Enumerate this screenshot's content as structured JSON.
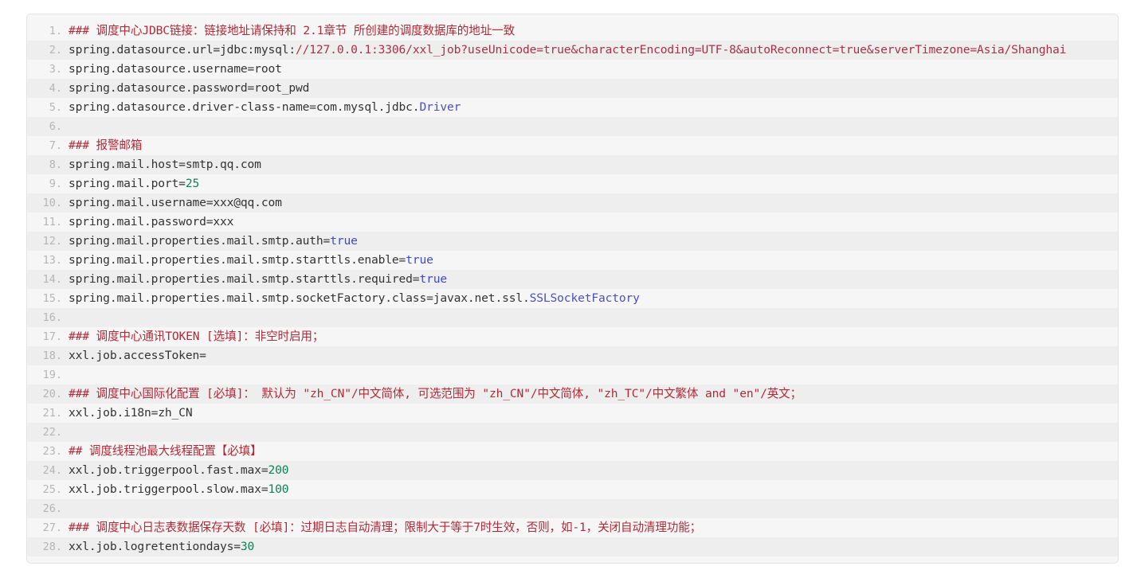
{
  "block": {
    "language": "properties",
    "colors": {
      "background_odd": "#f6f6f6",
      "background_even": "#eeeeee",
      "border": "#e4e4e4",
      "line_number": "#b5b5b5",
      "text": "#333333",
      "comment": "#b02a37",
      "number": "#0a8457",
      "boolean": "#3b49d6",
      "class": "#4a4fc4",
      "string": "#a8314a"
    }
  },
  "lines": [
    {
      "n": "1",
      "tokens": [
        {
          "t": "### 调度中心JDBC链接：链接地址请保持和 2.1章节 所创建的调度数据库的地址一致",
          "c": "tok-comment"
        }
      ]
    },
    {
      "n": "2",
      "tokens": [
        {
          "t": "spring.datasource.url=jdbc:mysql:",
          "c": "tok-key"
        },
        {
          "t": "//127.0.0.1:3306/xxl_job?useUnicode=true&characterEncoding=UTF-8&autoReconnect=true&serverTimezone=Asia/Shanghai",
          "c": "tok-str"
        }
      ]
    },
    {
      "n": "3",
      "tokens": [
        {
          "t": "spring.datasource.username=root",
          "c": "tok-key"
        }
      ]
    },
    {
      "n": "4",
      "tokens": [
        {
          "t": "spring.datasource.password=root_pwd",
          "c": "tok-key"
        }
      ]
    },
    {
      "n": "5",
      "tokens": [
        {
          "t": "spring.datasource.driver-class-name=com.mysql.jdbc.",
          "c": "tok-key"
        },
        {
          "t": "Driver",
          "c": "tok-class"
        }
      ]
    },
    {
      "n": "6",
      "tokens": [
        {
          "t": "",
          "c": "tok-plain"
        }
      ]
    },
    {
      "n": "7",
      "tokens": [
        {
          "t": "### 报警邮箱",
          "c": "tok-comment"
        }
      ]
    },
    {
      "n": "8",
      "tokens": [
        {
          "t": "spring.mail.host=smtp.qq.com",
          "c": "tok-key"
        }
      ]
    },
    {
      "n": "9",
      "tokens": [
        {
          "t": "spring.mail.port=",
          "c": "tok-key"
        },
        {
          "t": "25",
          "c": "tok-num"
        }
      ]
    },
    {
      "n": "10",
      "tokens": [
        {
          "t": "spring.mail.username=xxx@qq.com",
          "c": "tok-key"
        }
      ]
    },
    {
      "n": "11",
      "tokens": [
        {
          "t": "spring.mail.password=xxx",
          "c": "tok-key"
        }
      ]
    },
    {
      "n": "12",
      "tokens": [
        {
          "t": "spring.mail.properties.mail.smtp.auth=",
          "c": "tok-key"
        },
        {
          "t": "true",
          "c": "tok-bool"
        }
      ]
    },
    {
      "n": "13",
      "tokens": [
        {
          "t": "spring.mail.properties.mail.smtp.starttls.enable=",
          "c": "tok-key"
        },
        {
          "t": "true",
          "c": "tok-bool"
        }
      ]
    },
    {
      "n": "14",
      "tokens": [
        {
          "t": "spring.mail.properties.mail.smtp.starttls.required=",
          "c": "tok-key"
        },
        {
          "t": "true",
          "c": "tok-bool"
        }
      ]
    },
    {
      "n": "15",
      "tokens": [
        {
          "t": "spring.mail.properties.mail.smtp.socketFactory.class=javax.net.ssl.",
          "c": "tok-key"
        },
        {
          "t": "SSLSocketFactory",
          "c": "tok-class"
        }
      ]
    },
    {
      "n": "16",
      "tokens": [
        {
          "t": "",
          "c": "tok-plain"
        }
      ]
    },
    {
      "n": "17",
      "tokens": [
        {
          "t": "### 调度中心通讯TOKEN [选填]：非空时启用；",
          "c": "tok-comment"
        }
      ]
    },
    {
      "n": "18",
      "tokens": [
        {
          "t": "xxl.job.accessToken=",
          "c": "tok-key"
        }
      ]
    },
    {
      "n": "19",
      "tokens": [
        {
          "t": "",
          "c": "tok-plain"
        }
      ]
    },
    {
      "n": "20",
      "tokens": [
        {
          "t": "### 调度中心国际化配置 [必填]： 默认为 \"zh_CN\"/中文简体, 可选范围为 \"zh_CN\"/中文简体, \"zh_TC\"/中文繁体 and \"en\"/英文；",
          "c": "tok-comment"
        }
      ]
    },
    {
      "n": "21",
      "tokens": [
        {
          "t": "xxl.job.i18n=zh_CN",
          "c": "tok-key"
        }
      ]
    },
    {
      "n": "22",
      "tokens": [
        {
          "t": "",
          "c": "tok-plain"
        }
      ]
    },
    {
      "n": "23",
      "tokens": [
        {
          "t": "## 调度线程池最大线程配置【必填】",
          "c": "tok-comment"
        }
      ]
    },
    {
      "n": "24",
      "tokens": [
        {
          "t": "xxl.job.triggerpool.fast.max=",
          "c": "tok-key"
        },
        {
          "t": "200",
          "c": "tok-num"
        }
      ]
    },
    {
      "n": "25",
      "tokens": [
        {
          "t": "xxl.job.triggerpool.slow.max=",
          "c": "tok-key"
        },
        {
          "t": "100",
          "c": "tok-num"
        }
      ]
    },
    {
      "n": "26",
      "tokens": [
        {
          "t": "",
          "c": "tok-plain"
        }
      ]
    },
    {
      "n": "27",
      "tokens": [
        {
          "t": "### 调度中心日志表数据保存天数 [必填]：过期日志自动清理；限制大于等于7时生效，否则，如-1，关闭自动清理功能；",
          "c": "tok-comment"
        }
      ]
    },
    {
      "n": "28",
      "tokens": [
        {
          "t": "xxl.job.logretentiondays=",
          "c": "tok-key"
        },
        {
          "t": "30",
          "c": "tok-num"
        }
      ]
    }
  ]
}
